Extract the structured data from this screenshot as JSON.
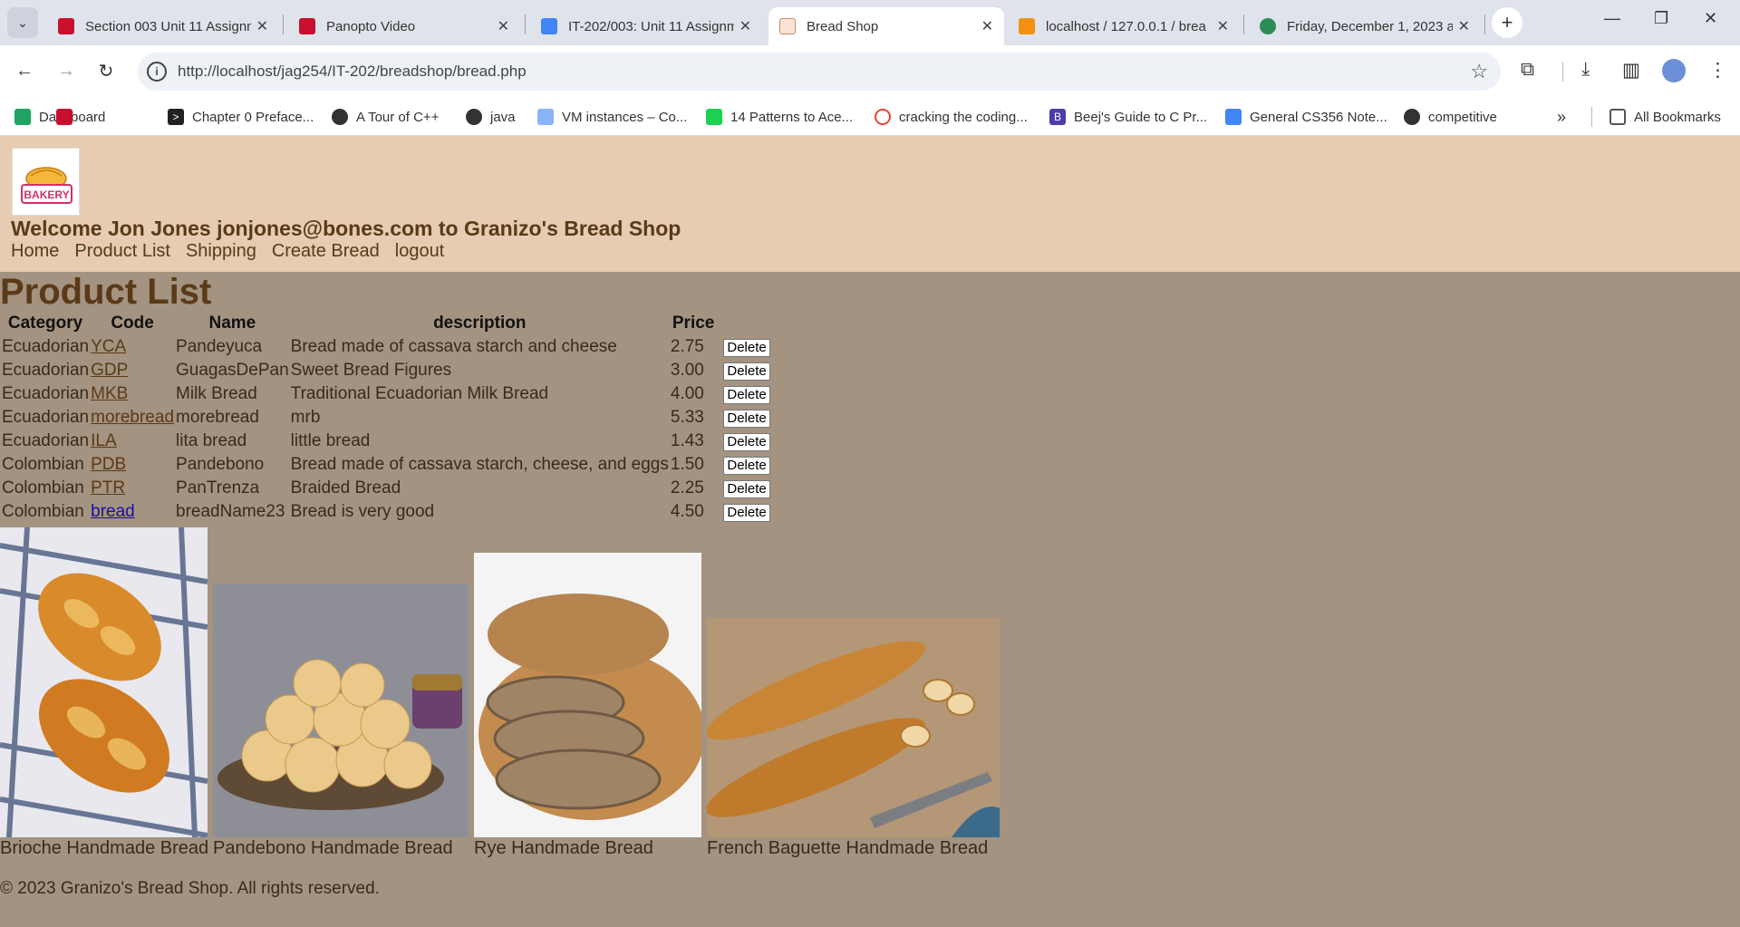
{
  "browser": {
    "tabs": [
      {
        "title": "Section 003 Unit 11 Assignm",
        "active": false
      },
      {
        "title": "Panopto Video",
        "active": false
      },
      {
        "title": "IT-202/003: Unit 11 Assignm",
        "active": false
      },
      {
        "title": "Bread Shop",
        "active": true
      },
      {
        "title": "localhost / 127.0.0.1 / brea",
        "active": false
      },
      {
        "title": "Friday, December 1, 2023 a",
        "active": false
      }
    ],
    "url": "http://localhost/jag254/IT-202/breadshop/bread.php",
    "bookmarks": [
      {
        "label": "Dashboard"
      },
      {
        "label": "Chapter 0 Preface..."
      },
      {
        "label": "A Tour of C++"
      },
      {
        "label": "java"
      },
      {
        "label": "VM instances – Co..."
      },
      {
        "label": "14 Patterns to Ace..."
      },
      {
        "label": "cracking the coding..."
      },
      {
        "label": "Beej's Guide to C Pr..."
      },
      {
        "label": "General CS356 Note..."
      },
      {
        "label": "competitive"
      }
    ],
    "all_bookmarks": "All Bookmarks"
  },
  "site": {
    "logo_text": "BAKERY",
    "welcome": "Welcome Jon Jones jonjones@bones.com to Granizo's Bread Shop",
    "nav": [
      "Home",
      "Product List",
      "Shipping",
      "Create Bread",
      "logout"
    ],
    "page_title": "Product List",
    "table": {
      "headers": [
        "Category",
        "Code",
        "Name",
        "description",
        "Price"
      ],
      "delete_label": "Delete",
      "rows": [
        {
          "category": "Ecuadorian",
          "code": "YCA",
          "name": "Pandeyuca",
          "description": "Bread made of cassava starch and cheese",
          "price": "2.75"
        },
        {
          "category": "Ecuadorian",
          "code": "GDP",
          "name": "GuagasDePan",
          "description": "Sweet Bread Figures",
          "price": "3.00"
        },
        {
          "category": "Ecuadorian",
          "code": "MKB",
          "name": "Milk Bread",
          "description": "Traditional Ecuadorian Milk Bread",
          "price": "4.00"
        },
        {
          "category": "Ecuadorian",
          "code": "morebread",
          "name": "morebread",
          "description": "mrb",
          "price": "5.33"
        },
        {
          "category": "Ecuadorian",
          "code": "ILA",
          "name": "lita bread",
          "description": "little bread",
          "price": "1.43"
        },
        {
          "category": "Colombian",
          "code": "PDB",
          "name": "Pandebono",
          "description": "Bread made of cassava starch, cheese, and eggs",
          "price": "1.50"
        },
        {
          "category": "Colombian",
          "code": "PTR",
          "name": "PanTrenza",
          "description": "Braided Bread",
          "price": "2.25"
        },
        {
          "category": "Colombian",
          "code": "bread",
          "name": "breadName23",
          "description": "Bread is very good",
          "price": "4.50"
        }
      ]
    },
    "gallery": [
      {
        "caption": "Brioche Handmade Bread"
      },
      {
        "caption": "Pandebono Handmade Bread"
      },
      {
        "caption": "Rye Handmade Bread"
      },
      {
        "caption": "French Baguette Handmade Bread"
      }
    ],
    "footer": "© 2023 Granizo's Bread Shop. All rights reserved."
  }
}
